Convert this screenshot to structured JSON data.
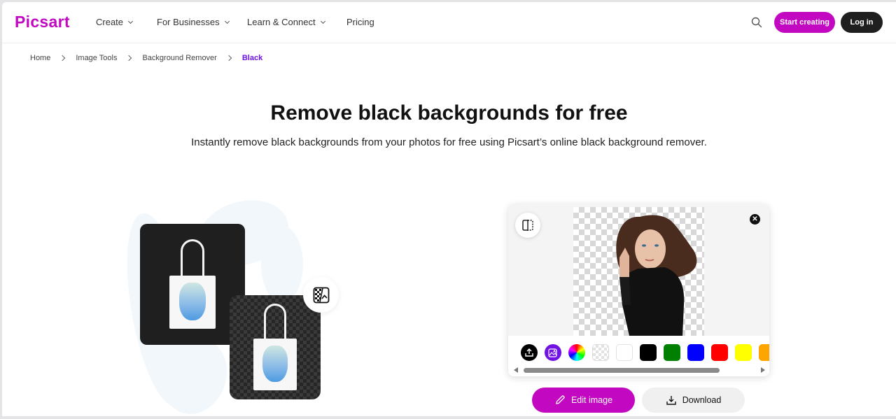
{
  "header": {
    "logo": "Picsart",
    "nav": [
      {
        "label": "Create",
        "has_dropdown": true
      },
      {
        "label": "For Businesses",
        "has_dropdown": true
      },
      {
        "label": "Learn & Connect",
        "has_dropdown": true
      },
      {
        "label": "Pricing",
        "has_dropdown": false
      }
    ],
    "search_icon": "search-icon",
    "start_label": "Start creating",
    "login_label": "Log in"
  },
  "breadcrumb": [
    {
      "label": "Home"
    },
    {
      "label": "Image Tools"
    },
    {
      "label": "Background Remover"
    },
    {
      "label": "Black",
      "active": true
    }
  ],
  "hero": {
    "title": "Remove black backgrounds for free",
    "subtitle": "Instantly remove black backgrounds from your photos for free using Picsart’s online black background remover."
  },
  "illustration": {
    "before_label": "tote bag on black background",
    "after_label": "tote bag with transparent background",
    "icon": "background-remove-icon"
  },
  "editor": {
    "compare_icon": "compare-icon",
    "close_icon": "close-icon",
    "preview_alt": "woman in black turtleneck with removed background",
    "tools": [
      {
        "name": "upload",
        "icon": "upload-icon"
      },
      {
        "name": "ai-background",
        "icon": "ai-image-icon"
      },
      {
        "name": "color-picker",
        "icon": "color-wheel-icon"
      }
    ],
    "swatches": [
      {
        "name": "transparent",
        "color": "transparent"
      },
      {
        "name": "white",
        "color": "#ffffff"
      },
      {
        "name": "black",
        "color": "#000000"
      },
      {
        "name": "green",
        "color": "#008000"
      },
      {
        "name": "blue",
        "color": "#0000ff"
      },
      {
        "name": "red",
        "color": "#ff0000"
      },
      {
        "name": "yellow",
        "color": "#ffff00"
      },
      {
        "name": "orange",
        "color": "#ffa500"
      }
    ],
    "edit_label": "Edit image",
    "download_label": "Download"
  },
  "colors": {
    "brand": "#c209c1",
    "breadcrumb_active": "#6f12e3",
    "dark_button": "#1f1f1f"
  }
}
